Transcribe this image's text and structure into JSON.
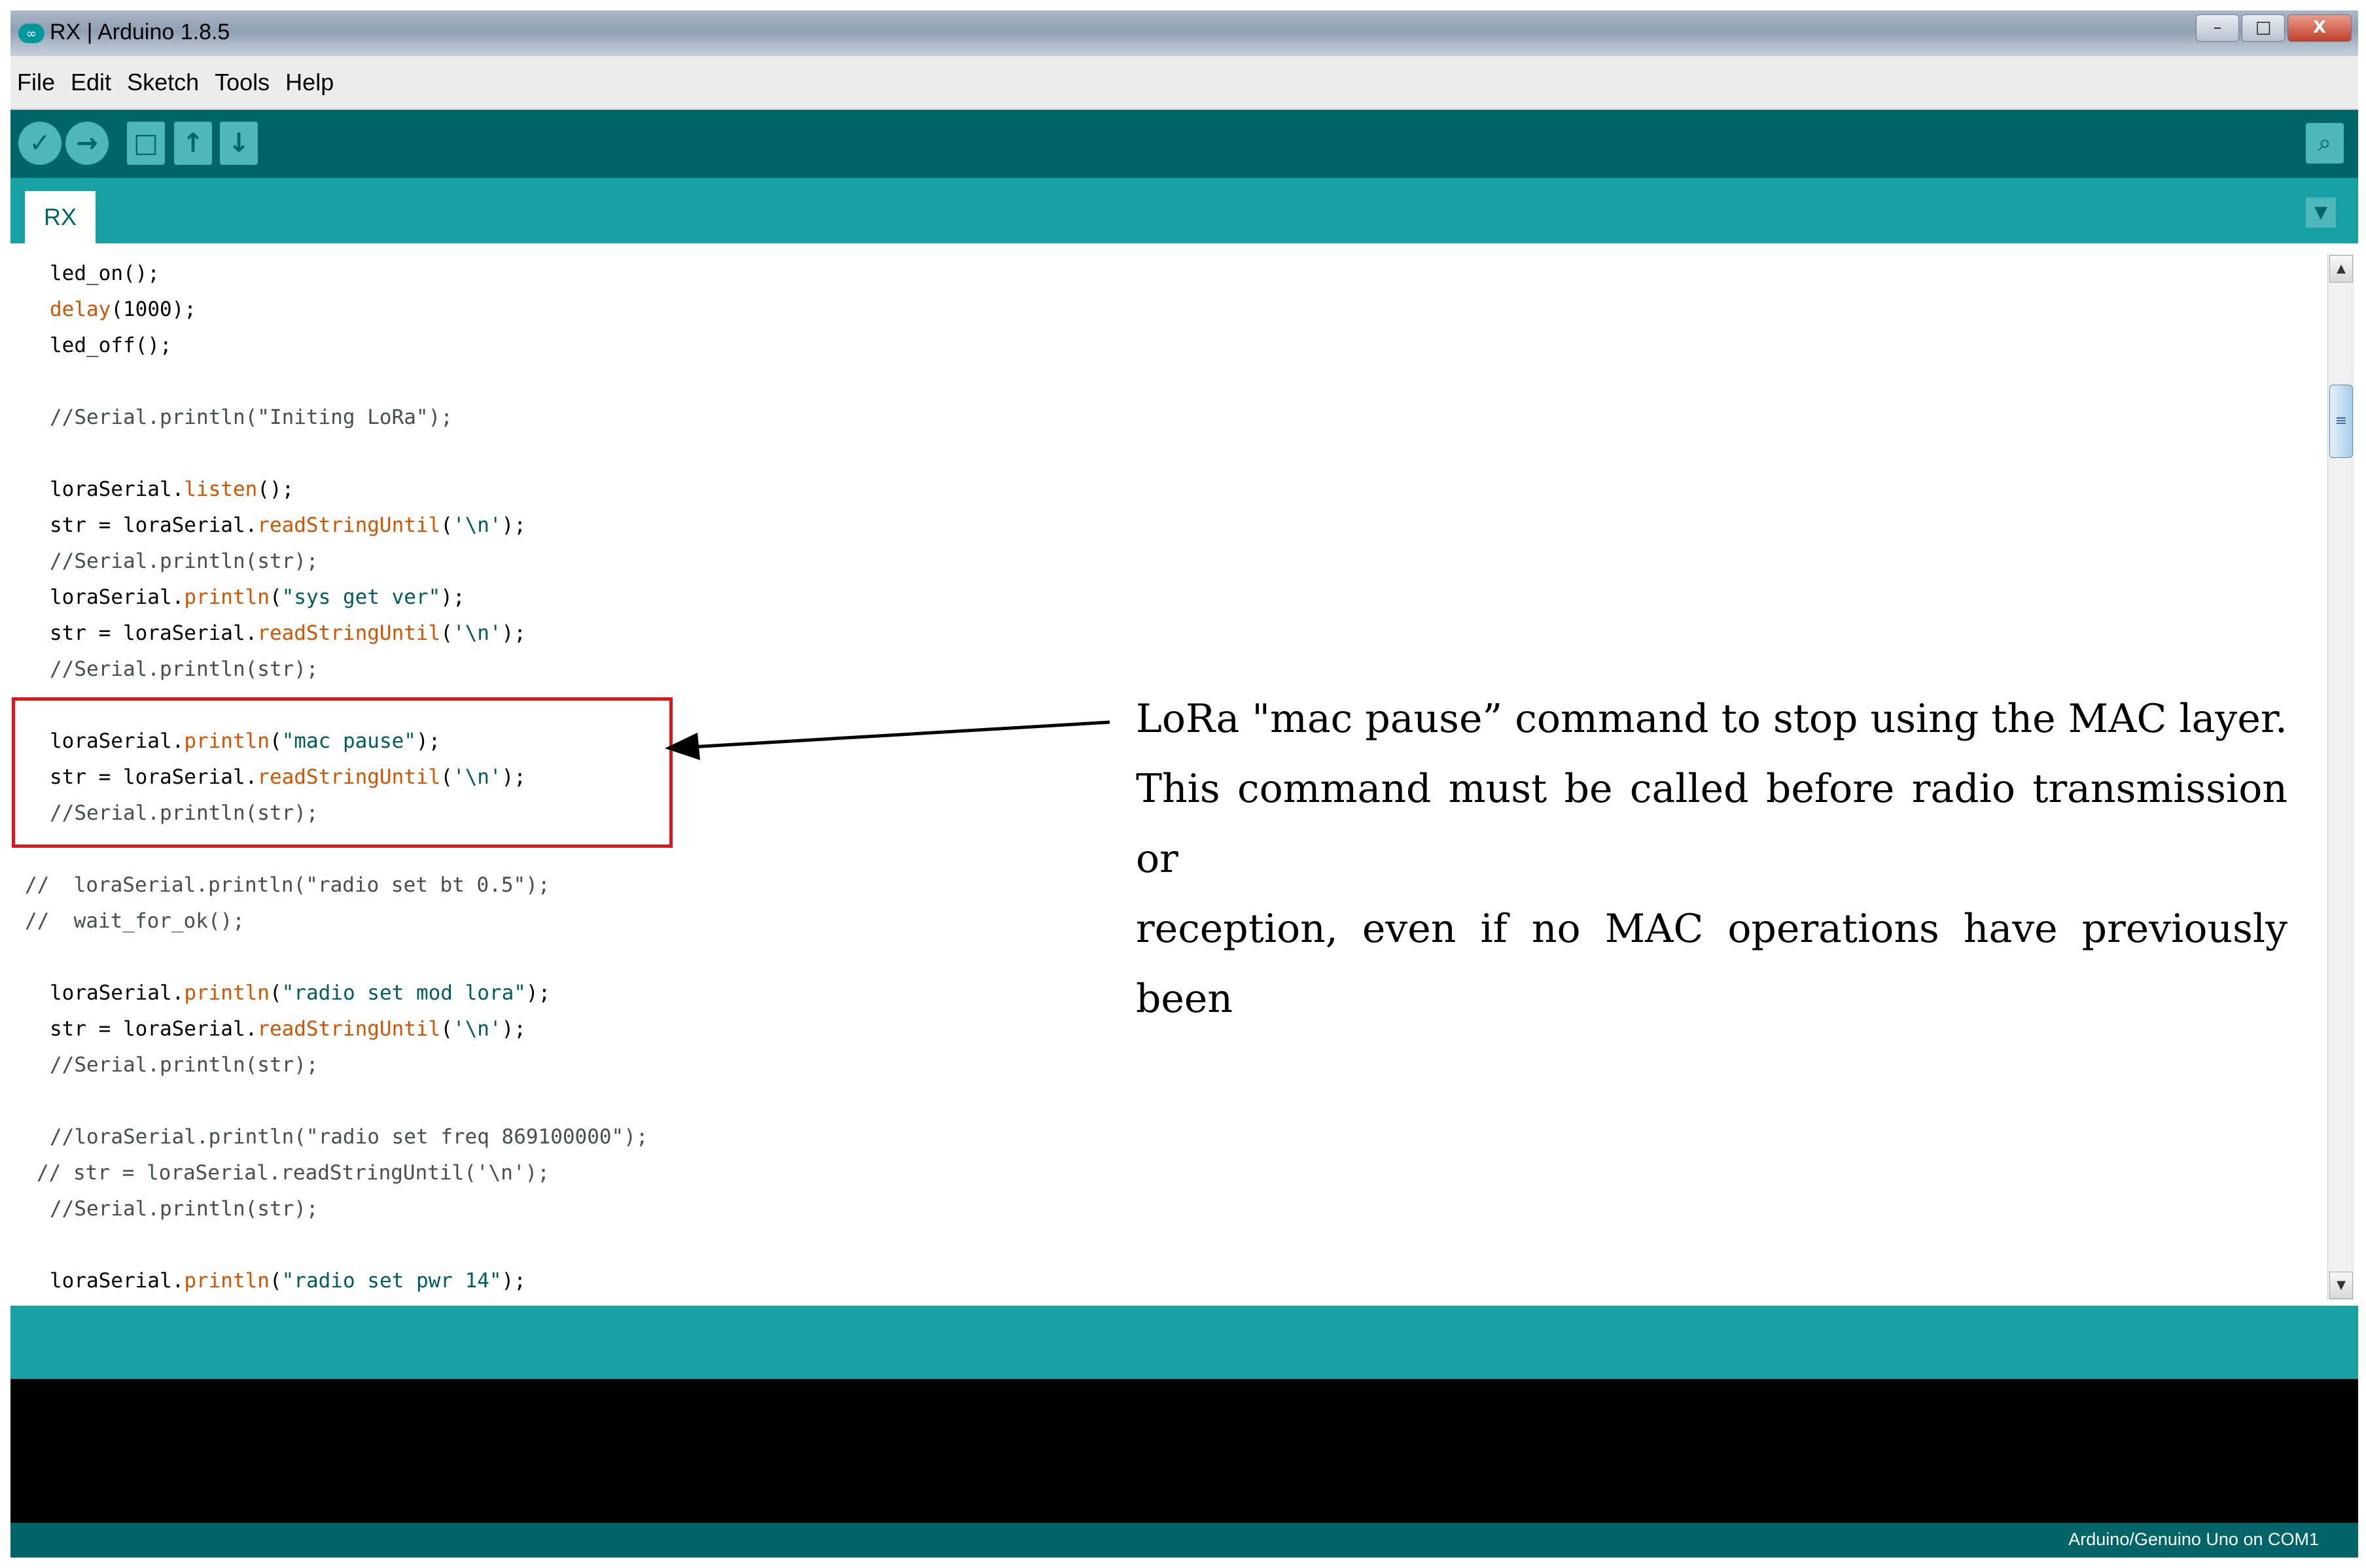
{
  "window": {
    "title": "RX | Arduino 1.8.5",
    "controls": [
      "–",
      "□",
      "X"
    ]
  },
  "menu": [
    "File",
    "Edit",
    "Sketch",
    "Tools",
    "Help"
  ],
  "toolbar": {
    "verify_icon": "✓",
    "upload_icon": "→",
    "new_icon": "□",
    "open_icon": "↑",
    "save_icon": "↓",
    "serial_icon": "⌕"
  },
  "tab": {
    "label": "RX",
    "menu_icon": "▼"
  },
  "code_lines": [
    "led_on();",
    "delay(1000);",
    "led_off();",
    "",
    "//Serial.println(\"Initing LoRa\");",
    "",
    "loraSerial.listen();",
    "str = loraSerial.readStringUntil('\\n');",
    "//Serial.println(str);",
    "loraSerial.println(\"sys get ver\");",
    "str = loraSerial.readStringUntil('\\n');",
    "//Serial.println(str);",
    "",
    "loraSerial.println(\"mac pause\");",
    "str = loraSerial.readStringUntil('\\n');",
    "//Serial.println(str);",
    "",
    "//  loraSerial.println(\"radio set bt 0.5\");",
    "//  wait_for_ok();",
    "",
    "loraSerial.println(\"radio set mod lora\");",
    "str = loraSerial.readStringUntil('\\n');",
    "//Serial.println(str);",
    "",
    "//loraSerial.println(\"radio set freq 869100000\");",
    "// str = loraSerial.readStringUntil('\\n');",
    "//Serial.println(str);",
    "",
    "loraSerial.println(\"radio set pwr 14\");"
  ],
  "annotation": {
    "line1": "LoRa \"mac pause” command to stop using the MAC layer.",
    "line2": "This command must be called before radio transmission or",
    "line3": "reception, even if no MAC operations have previously been"
  },
  "status": "Arduino/Genuino Uno on COM1",
  "colors": {
    "teal_dark": "#006468",
    "teal": "#17a1a5",
    "keyword": "#d35400",
    "string": "#005c5f",
    "highlight_box": "#e0141b"
  }
}
